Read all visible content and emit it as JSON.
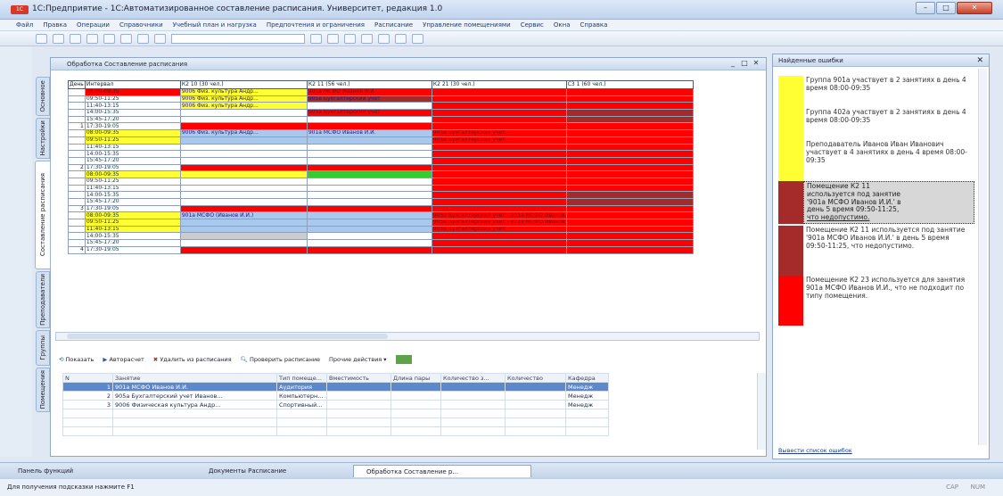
{
  "window": {
    "title": "1С:Предприятие - 1С:Автоматизированное составление расписания. Университет, редакция 1.0",
    "app_icon_text": "1С"
  },
  "menu": [
    "Файл",
    "Правка",
    "Операции",
    "Справочники",
    "Учебный план и нагрузка",
    "Предпочтения и ограничения",
    "Расписание",
    "Управление помещениями",
    "Сервис",
    "Окна",
    "Справка"
  ],
  "process_window": {
    "title": "Обработка  Составление расписания"
  },
  "left_tabs": [
    "Основное",
    "Настройки",
    "Составление расписания",
    "Преподаватели",
    "Группы",
    "Помещения"
  ],
  "grid": {
    "headers": [
      "День",
      "Интервал",
      "К2 10 (30 чел.)",
      "К2 11 (56 чел.)",
      "К2 21 (30 чел.)",
      "С3 1 (60 чел.)"
    ],
    "days": [
      "1",
      "2",
      "3",
      "4"
    ],
    "intervals": [
      "08:00-09:35",
      "09:50-11:25",
      "11:40-13:15",
      "14:00-15:35",
      "15:45-17:20",
      "17:30-19:05"
    ],
    "cells": {
      "d1_i1_k210": "9006 Физ. культура Андр...",
      "d1_i1_k211": "901а МСФО Иванов И.И.",
      "d1_i2_k210": "9006 Физ. культура Андр...",
      "d1_i2_k211": "905а Бухгалтерский учет",
      "d1_i3_k210": "9006 Физ. культура Андр...",
      "d1_i4_k211": "905а Бухгалтерский учет",
      "d2_i1_k221": "905а Бухгалтерский учет",
      "d2_i2_k221": "905а Бухгалтерский учет",
      "d2_i1_k210": "9006 Физ. культура Андр...",
      "d2_i1_k211": "901а МСФО Иванов И.И.",
      "d4_i1_k210": "901а МСФО (Иванов И.И.)",
      "d4_i1_k221": "905а Бухгалтерский учет - 901а МСФО Иванов",
      "d4_i2_k221": "905а Бухгалтерский учет - 901а МСФО Иванов",
      "d4_i3_k221": "905а Бухгалтерский учет"
    },
    "colors": {
      "red": "#ff0000",
      "dark_red": "#a52a2a",
      "yellow": "#ffff33",
      "light_blue": "#a8c8ee",
      "green": "#33cc33",
      "grey": "#cccccc"
    }
  },
  "bottom_toolbar": {
    "show": "Показать",
    "autoset": "Авторасчет",
    "remove": "Удалить из расписания",
    "check": "Проверить расписание",
    "other": "Прочие действия"
  },
  "lessons_table": {
    "headers": [
      "N",
      "Занятие",
      "Тип помеще...",
      "Вместимость",
      "Длина пары",
      "Количество з...",
      "Количество",
      "Кафедра"
    ],
    "rows": [
      {
        "n": "1",
        "lesson": "901а МСФО Иванов И.И.",
        "room_type": "Аудитория",
        "capacity": "",
        "length": "",
        "count_z": "",
        "count": "",
        "dept": "Менедж"
      },
      {
        "n": "2",
        "lesson": "905а Бухгалтерский учет Иванов...",
        "room_type": "Компьютерн...",
        "capacity": "",
        "length": "",
        "count_z": "",
        "count": "",
        "dept": "Менедж"
      },
      {
        "n": "3",
        "lesson": "9006 Физическая культура Андр...",
        "room_type": "Спортивный...",
        "capacity": "",
        "length": "",
        "count_z": "",
        "count": "",
        "dept": "Менедж"
      }
    ]
  },
  "errors_panel": {
    "title": "Найденные ошибки",
    "footer_link": "Вывести список ошибок",
    "items": [
      {
        "color": "#ffff33",
        "text": "Группа 901а участвует в 2 занятиях в день 4 время 08:00-09:35"
      },
      {
        "color": "#ffff33",
        "text": "Группа 402а участвует в 2 занятиях в день 4 время 08:00-09:35"
      },
      {
        "color": "#ffff33",
        "text": "Преподаватель Иванов Иван Иванович участвует в 4 занятиях в день 4 время 08:00-09:35"
      },
      {
        "color": "#a52a2a",
        "text_lines": [
          "Помещение К2 11",
          "используется под занятие",
          "'901а МСФО Иванов И.И.' в",
          "день 5 время 09:50-11:25,"
        ],
        "underlined": "что недопустимо."
      },
      {
        "color": "#a52a2a",
        "text": "Помещение К2 11 используется под занятие '901а МСФО Иванов И.И.' в день 5 время 09:50-11:25, что недопустимо."
      },
      {
        "color": "#ff0000",
        "text": "Помещение К2 23 используется для занятия 901а МСФО Иванов И.И., что не подходит по типу помещения."
      }
    ]
  },
  "taskbar": [
    "Панель функций",
    "Документы Расписание",
    "Обработка Составление р..."
  ],
  "status": {
    "hint": "Для получения подсказки нажмите F1",
    "caps": "CAP",
    "num": "NUM"
  }
}
